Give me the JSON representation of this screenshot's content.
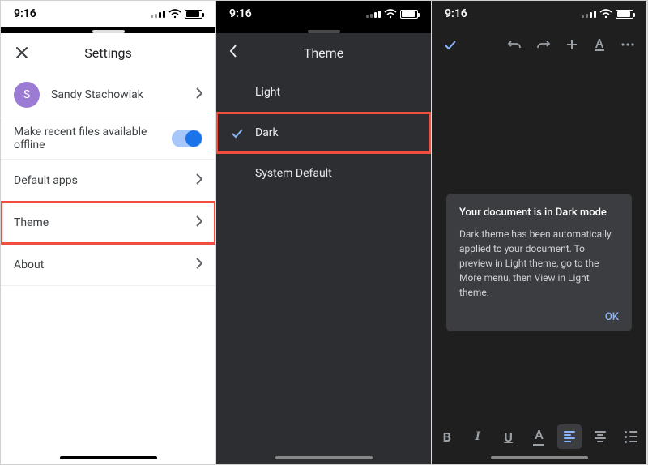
{
  "status": {
    "time": "9:16"
  },
  "screen1": {
    "title": "Settings",
    "profile": {
      "initial": "S",
      "name": "Sandy Stachowiak"
    },
    "offline_label": "Make recent files available offline",
    "rows": {
      "default_apps": "Default apps",
      "theme": "Theme",
      "about": "About"
    }
  },
  "screen2": {
    "title": "Theme",
    "options": {
      "light": "Light",
      "dark": "Dark",
      "system": "System Default"
    },
    "selected": "dark"
  },
  "screen3": {
    "dialog": {
      "title": "Your document is in Dark mode",
      "body": "Dark theme has been automatically applied to your document. To preview in Light theme, go to the More menu, then View in Light theme.",
      "ok": "OK"
    },
    "toolbar": {
      "bold": "B",
      "italic": "I",
      "underline": "U",
      "textcolor": "A"
    }
  }
}
